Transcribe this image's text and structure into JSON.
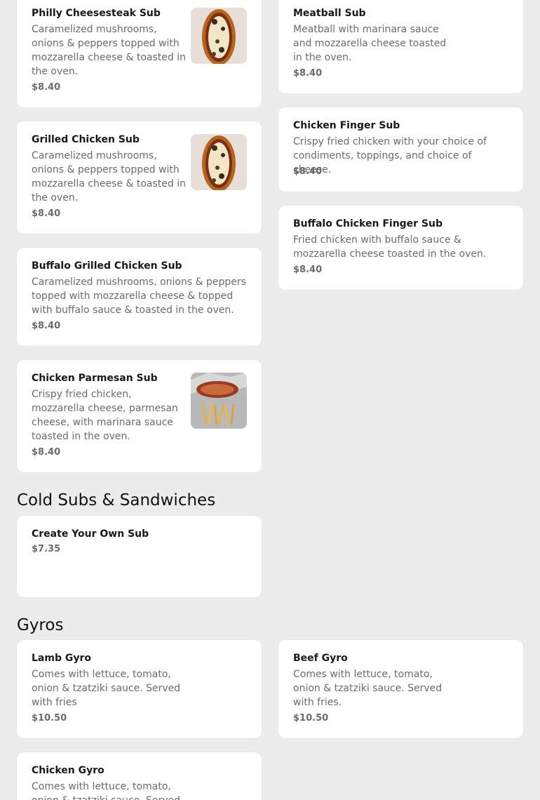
{
  "sections": {
    "cold": {
      "title": "Cold Subs & Sandwiches"
    },
    "gyros": {
      "title": "Gyros"
    }
  },
  "items": {
    "philly": {
      "name": "Philly Cheesesteak Sub",
      "desc": "Caramelized mushrooms, onions & peppers topped with mozzarella cheese & toasted in the oven.",
      "price": "$8.40",
      "image": "sub-sandwich-photo"
    },
    "meatball": {
      "name": "Meatball Sub",
      "desc": "Meatball with marinara sauce and mozzarella cheese toasted in the oven.",
      "price": "$8.40"
    },
    "grilled": {
      "name": "Grilled Chicken Sub",
      "desc": "Caramelized mushrooms, onions & peppers topped with mozzarella cheese & toasted in the oven.",
      "price": "$8.40",
      "image": "sub-sandwich-photo"
    },
    "finger": {
      "name": "Chicken Finger Sub",
      "desc": "Crispy fried chicken with your choice of condiments, toppings, and choice of cheese.",
      "price": "$8.40"
    },
    "buffalo_finger": {
      "name": "Buffalo Chicken Finger Sub",
      "desc": "Fried chicken with buffalo sauce & mozzarella cheese toasted in the oven.",
      "price": "$8.40"
    },
    "buffalo_grilled": {
      "name": "Buffalo Grilled Chicken Sub",
      "desc": "Caramelized mushrooms, onions & peppers topped with mozzarella cheese & topped with buffalo sauce & toasted in the oven.",
      "price": "$8.40"
    },
    "parmesan": {
      "name": "Chicken Parmesan Sub",
      "desc": "Crispy fried chicken, mozzarella cheese, parmesan cheese, with marinara sauce toasted in the oven.",
      "price": "$8.40",
      "image": "sub-with-fries-photo"
    },
    "create": {
      "name": "Create Your Own Sub",
      "price": "$7.35"
    },
    "lamb": {
      "name": "Lamb Gyro",
      "desc": "Comes with lettuce, tomato, onion & tzatziki sauce. Served with fries",
      "price": "$10.50"
    },
    "beef": {
      "name": "Beef Gyro",
      "desc": "Comes with lettuce, tomato, onion & tzatziki sauce. Served with fries.",
      "price": "$10.50"
    },
    "chicken_gyro": {
      "name": "Chicken Gyro",
      "desc": "Comes with lettuce, tomato, onion & tzatziki sauce. Served with fries"
    }
  }
}
